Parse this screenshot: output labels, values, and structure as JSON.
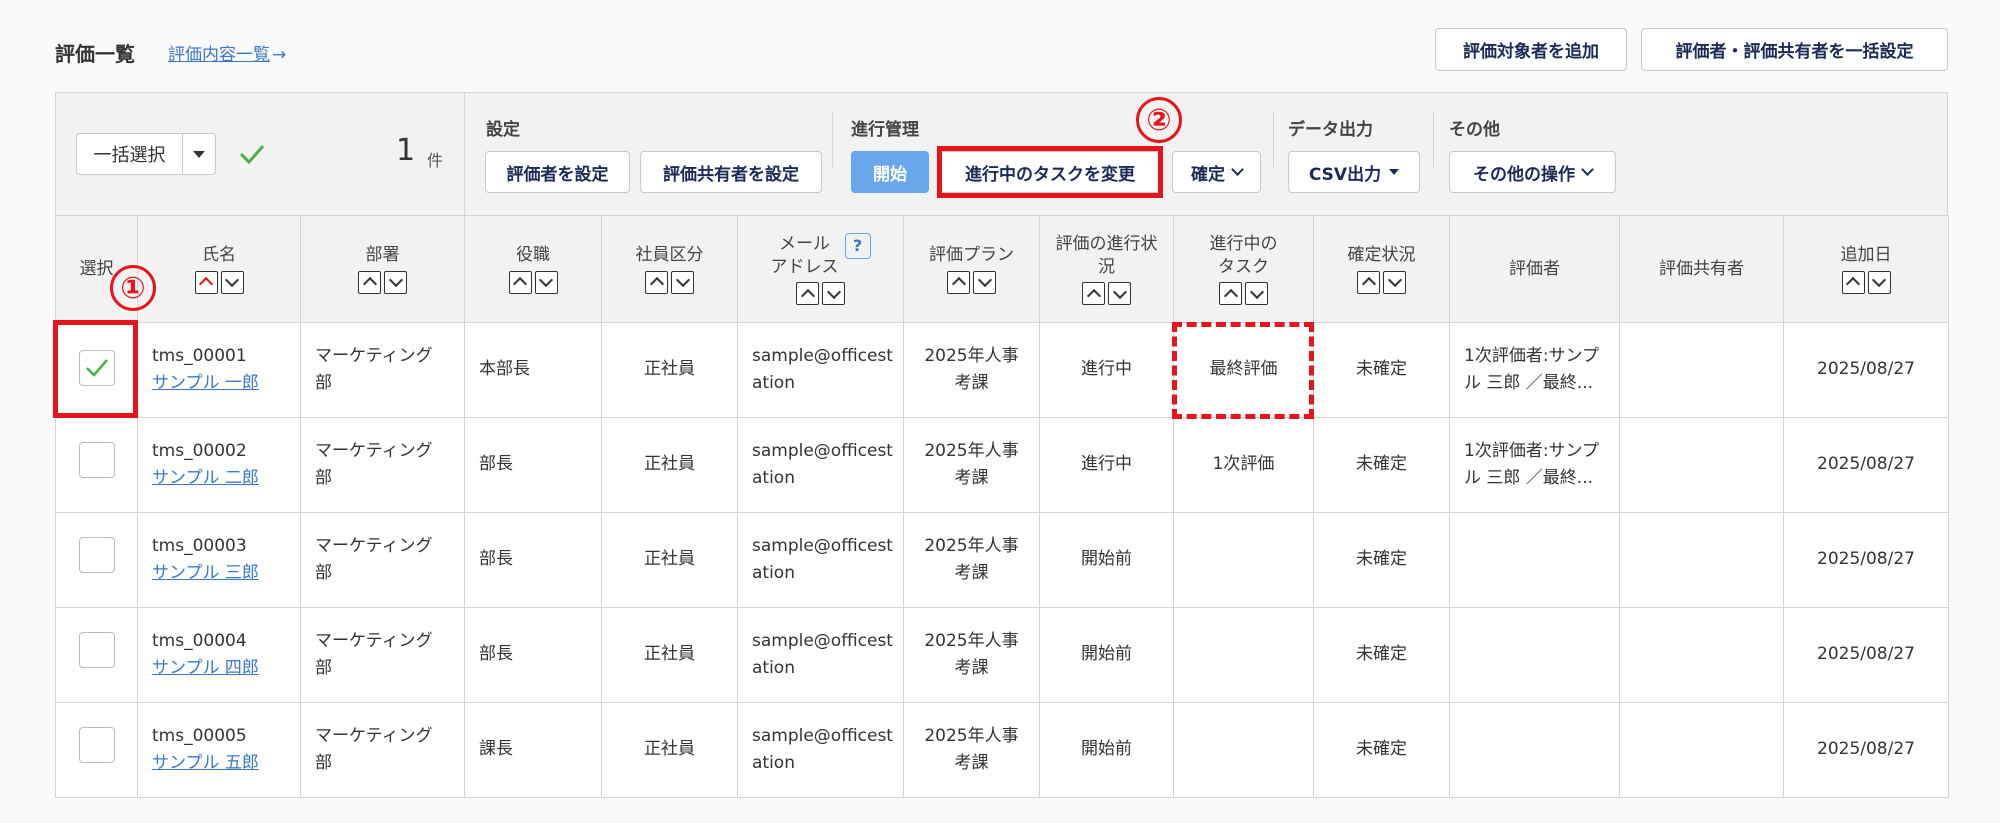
{
  "header": {
    "title": "評価一覧",
    "link_label": "評価内容一覧",
    "link_arrow": "→",
    "add_target_button": "評価対象者を追加",
    "bulk_setting_button": "評価者・評価共有者を一括設定"
  },
  "toolbar": {
    "bulk_select_label": "一括選択",
    "selected_count": "1",
    "count_unit": "件",
    "settings": {
      "label": "設定",
      "set_evaluator": "評価者を設定",
      "set_sharer": "評価共有者を設定"
    },
    "progress": {
      "label": "進行管理",
      "start": "開始",
      "change_task": "進行中のタスクを変更",
      "confirm": "確定"
    },
    "export": {
      "label": "データ出力",
      "csv": "CSV出力"
    },
    "other": {
      "label": "その他",
      "other_actions": "その他の操作"
    }
  },
  "annotations": {
    "marker1": "①",
    "marker2": "②",
    "accent_color": "#e8141b"
  },
  "table": {
    "headers": {
      "select": "選択",
      "name": "氏名",
      "dept": "部署",
      "position": "役職",
      "emp_type": "社員区分",
      "email_1": "メール",
      "email_2": "アドレス",
      "help": "?",
      "plan": "評価プラン",
      "status_1": "評価の進行状",
      "status_2": "況",
      "task_1": "進行中の",
      "task_2": "タスク",
      "confirm": "確定状況",
      "evaluator": "評価者",
      "sharer": "評価共有者",
      "added": "追加日"
    },
    "rows": [
      {
        "checked": true,
        "id": "tms_00001",
        "name": "サンプル 一郎",
        "dept_1": "マーケティング",
        "dept_2": "部",
        "position": "本部長",
        "emp_type": "正社員",
        "email_1": "sample@officest",
        "email_2": "ation",
        "plan_1": "2025年人事",
        "plan_2": "考課",
        "status": "進行中",
        "task": "最終評価",
        "confirm": "未確定",
        "evaluator_1": "1次評価者:サンプ",
        "evaluator_2": "ル 三郎 ／最終...",
        "sharer": "",
        "added": "2025/08/27"
      },
      {
        "checked": false,
        "id": "tms_00002",
        "name": "サンプル 二郎",
        "dept_1": "マーケティング",
        "dept_2": "部",
        "position": "部長",
        "emp_type": "正社員",
        "email_1": "sample@officest",
        "email_2": "ation",
        "plan_1": "2025年人事",
        "plan_2": "考課",
        "status": "進行中",
        "task": "1次評価",
        "confirm": "未確定",
        "evaluator_1": "1次評価者:サンプ",
        "evaluator_2": "ル 三郎 ／最終...",
        "sharer": "",
        "added": "2025/08/27"
      },
      {
        "checked": false,
        "id": "tms_00003",
        "name": "サンプル 三郎",
        "dept_1": "マーケティング",
        "dept_2": "部",
        "position": "部長",
        "emp_type": "正社員",
        "email_1": "sample@officest",
        "email_2": "ation",
        "plan_1": "2025年人事",
        "plan_2": "考課",
        "status": "開始前",
        "task": "",
        "confirm": "未確定",
        "evaluator_1": "",
        "evaluator_2": "",
        "sharer": "",
        "added": "2025/08/27"
      },
      {
        "checked": false,
        "id": "tms_00004",
        "name": "サンプル 四郎",
        "dept_1": "マーケティング",
        "dept_2": "部",
        "position": "部長",
        "emp_type": "正社員",
        "email_1": "sample@officest",
        "email_2": "ation",
        "plan_1": "2025年人事",
        "plan_2": "考課",
        "status": "開始前",
        "task": "",
        "confirm": "未確定",
        "evaluator_1": "",
        "evaluator_2": "",
        "sharer": "",
        "added": "2025/08/27"
      },
      {
        "checked": false,
        "id": "tms_00005",
        "name": "サンプル 五郎",
        "dept_1": "マーケティング",
        "dept_2": "部",
        "position": "課長",
        "emp_type": "正社員",
        "email_1": "sample@officest",
        "email_2": "ation",
        "plan_1": "2025年人事",
        "plan_2": "考課",
        "status": "開始前",
        "task": "",
        "confirm": "未確定",
        "evaluator_1": "",
        "evaluator_2": "",
        "sharer": "",
        "added": "2025/08/27"
      }
    ]
  }
}
